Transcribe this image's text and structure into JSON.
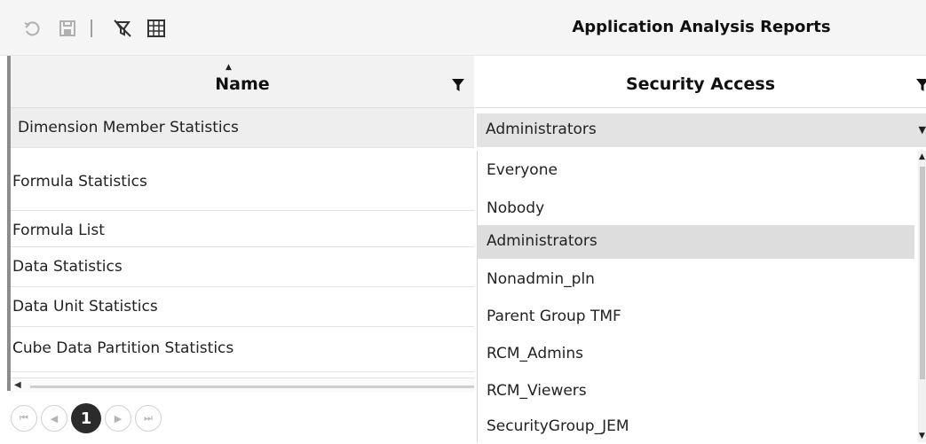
{
  "toolbar": {
    "title": "Application Analysis Reports",
    "icons": [
      "undo-icon",
      "save-icon",
      "clear-filter-icon",
      "grid-settings-icon"
    ]
  },
  "grid": {
    "columns": [
      {
        "label": "Name",
        "sort": "ascending"
      },
      {
        "label": "Security Access"
      }
    ],
    "rows": [
      "Dimension Member Statistics",
      "Formula Statistics",
      "Formula List",
      "Data Statistics",
      "Data Unit Statistics",
      "Cube Data Partition Statistics"
    ],
    "selected_row_index": 0
  },
  "security_select": {
    "value": "Administrators",
    "options": [
      "Everyone",
      "Nobody",
      "Administrators",
      "Nonadmin_pln",
      "Parent Group TMF",
      "RCM_Admins",
      "RCM_Viewers",
      "SecurityGroup_JEM"
    ],
    "highlighted": "Administrators"
  },
  "pager": {
    "current_page": "1"
  },
  "colors": {
    "toolbar_bg": "#f5f5f5",
    "header_bg": "#f2f2f2",
    "selected_row": "#eeeeee",
    "highlight_option": "#dddddd",
    "active_page": "#2b2b2b"
  }
}
